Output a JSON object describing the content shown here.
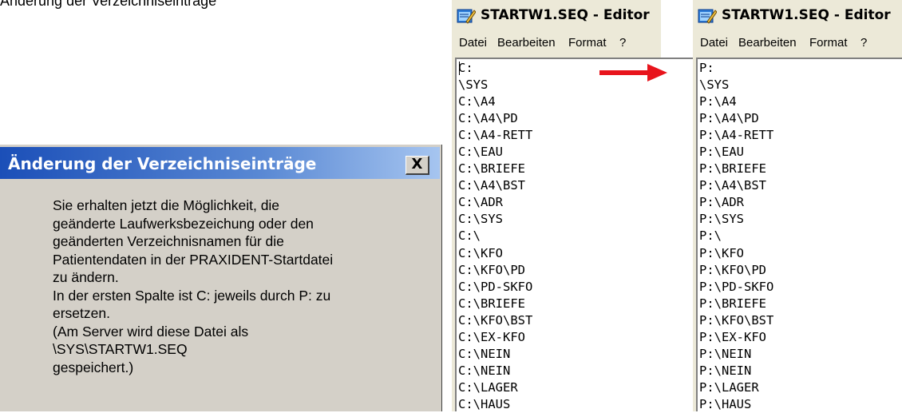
{
  "top_text": "Änderung der Verzeichniseinträge",
  "dialog": {
    "title": "Änderung der Verzeichniseinträge",
    "close_label": "X",
    "lines": [
      "Sie erhalten jetzt die Möglichkeit, die",
      "geänderte Laufwerksbezeichung oder den",
      "geänderten Verzeichnisnamen für die",
      "Patientendaten in der PRAXIDENT-Startdatei",
      "zu ändern.",
      "In der ersten Spalte ist C: jeweils durch  P: zu",
      "ersetzen.",
      "(Am Server wird diese Datei als",
      "\\SYS\\STARTW1.SEQ",
      "gespeichert.)"
    ]
  },
  "editor_before": {
    "title": "STARTW1.SEQ - Editor",
    "icon": "notepad-icon",
    "menu": [
      "Datei",
      "Bearbeiten",
      "Format",
      "?"
    ],
    "lines": [
      "C:",
      "\\SYS",
      "C:\\A4",
      "C:\\A4\\PD",
      "C:\\A4-RETT",
      "C:\\EAU",
      "C:\\BRIEFE",
      "C:\\A4\\BST",
      "C:\\ADR",
      "C:\\SYS",
      "C:\\",
      "C:\\KFO",
      "C:\\KFO\\PD",
      "C:\\PD-SKFO",
      "C:\\BRIEFE",
      "C:\\KFO\\BST",
      "C:\\EX-KFO",
      "C:\\NEIN",
      "C:\\NEIN",
      "C:\\LAGER",
      "C:\\HAUS"
    ]
  },
  "editor_after": {
    "title": "STARTW1.SEQ - Editor",
    "icon": "notepad-icon",
    "menu": [
      "Datei",
      "Bearbeiten",
      "Format",
      "?"
    ],
    "lines": [
      "P:",
      "\\SYS",
      "P:\\A4",
      "P:\\A4\\PD",
      "P:\\A4-RETT",
      "P:\\EAU",
      "P:\\BRIEFE",
      "P:\\A4\\BST",
      "P:\\ADR",
      "P:\\SYS",
      "P:\\",
      "P:\\KFO",
      "P:\\KFO\\PD",
      "P:\\PD-SKFO",
      "P:\\BRIEFE",
      "P:\\KFO\\BST",
      "P:\\EX-KFO",
      "P:\\NEIN",
      "P:\\NEIN",
      "P:\\LAGER",
      "P:\\HAUS"
    ]
  },
  "colors": {
    "arrow": "#e8141c",
    "titlebar": "#1b4fb8"
  }
}
